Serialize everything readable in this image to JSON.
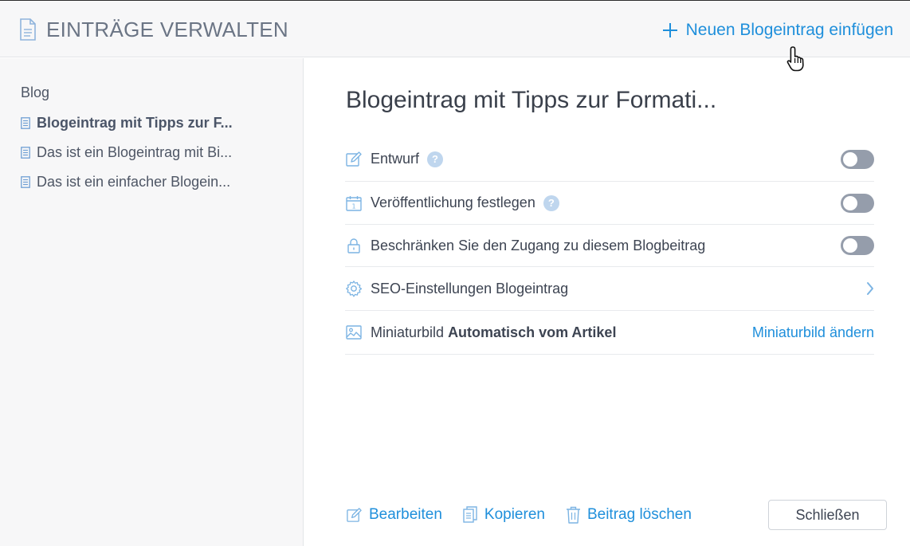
{
  "header": {
    "title": "EINTRÄGE VERWALTEN",
    "add_entry_label": "Neuen Blogeintrag einfügen"
  },
  "sidebar": {
    "root": "Blog",
    "items": [
      {
        "label": "Blogeintrag mit Tipps zur F...",
        "active": true
      },
      {
        "label": "Das ist ein Blogeintrag mit Bi...",
        "active": false
      },
      {
        "label": "Das ist ein einfacher Blogein...",
        "active": false
      }
    ]
  },
  "main": {
    "title": "Blogeintrag mit Tipps zur Formati...",
    "settings": {
      "draft": {
        "label": "Entwurf",
        "help": "?",
        "enabled": false
      },
      "schedule": {
        "label": "Veröffentlichung festlegen",
        "help": "?",
        "enabled": false
      },
      "restrict": {
        "label": "Beschränken Sie den Zugang zu diesem Blogbeitrag",
        "enabled": false
      },
      "seo": {
        "label": "SEO-Einstellungen Blogeintrag"
      },
      "thumbnail": {
        "label": "Miniaturbild",
        "value": "Automatisch vom Artikel",
        "action": "Miniaturbild ändern"
      }
    }
  },
  "footer": {
    "edit": "Bearbeiten",
    "copy": "Kopieren",
    "delete": "Beitrag löschen",
    "close": "Schließen"
  },
  "colors": {
    "accent": "#1f8fdb",
    "icon": "#7cb4e3",
    "toggle_off": "#959dab",
    "panel_bg": "#f7f7f8"
  }
}
